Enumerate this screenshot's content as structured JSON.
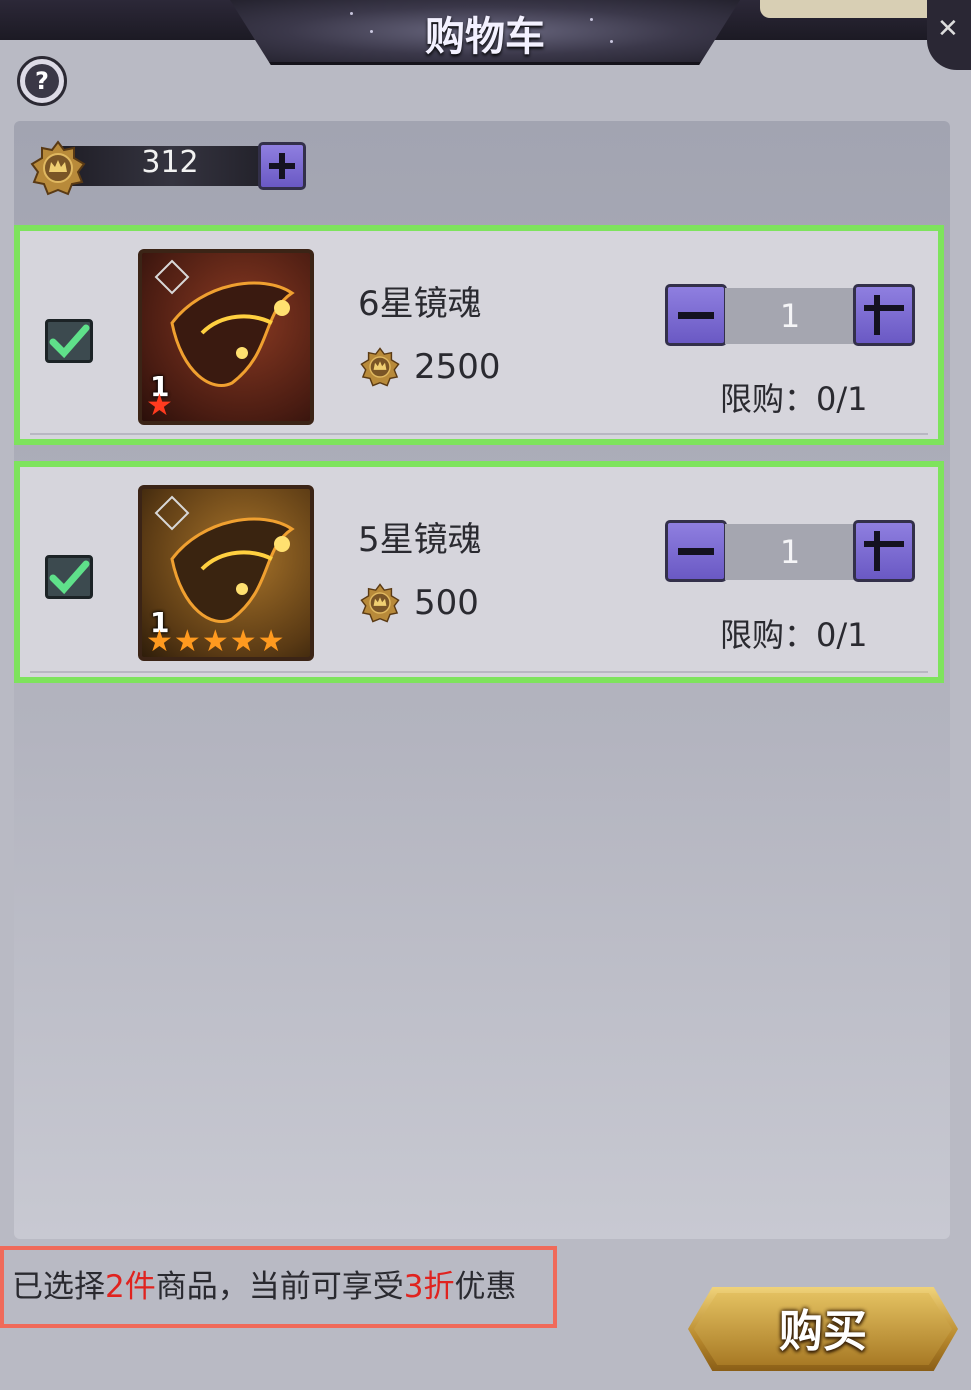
{
  "header": {
    "title": "购物车"
  },
  "help": {
    "label": "?"
  },
  "currency": {
    "amount": "312",
    "icon": "crown-coin-icon"
  },
  "items": [
    {
      "name": "6星镜魂",
      "price": "2500",
      "level": "1",
      "stars": 1,
      "quantity": "1",
      "limit_label": "限购：0/1",
      "checked": true
    },
    {
      "name": "5星镜魂",
      "price": "500",
      "level": "1",
      "stars": 5,
      "quantity": "1",
      "limit_label": "限购：0/1",
      "checked": true
    }
  ],
  "footer": {
    "prefix": "已选择",
    "count": "2件",
    "middle": "商品，当前可享受",
    "discount": "3折",
    "suffix": "优惠"
  },
  "buy_button": {
    "label": "购买"
  },
  "colors": {
    "card_border": "#7ee35d",
    "accent_purple": "#7a68d2",
    "highlight_red": "#e0231f",
    "gold": "#d4a94a"
  }
}
